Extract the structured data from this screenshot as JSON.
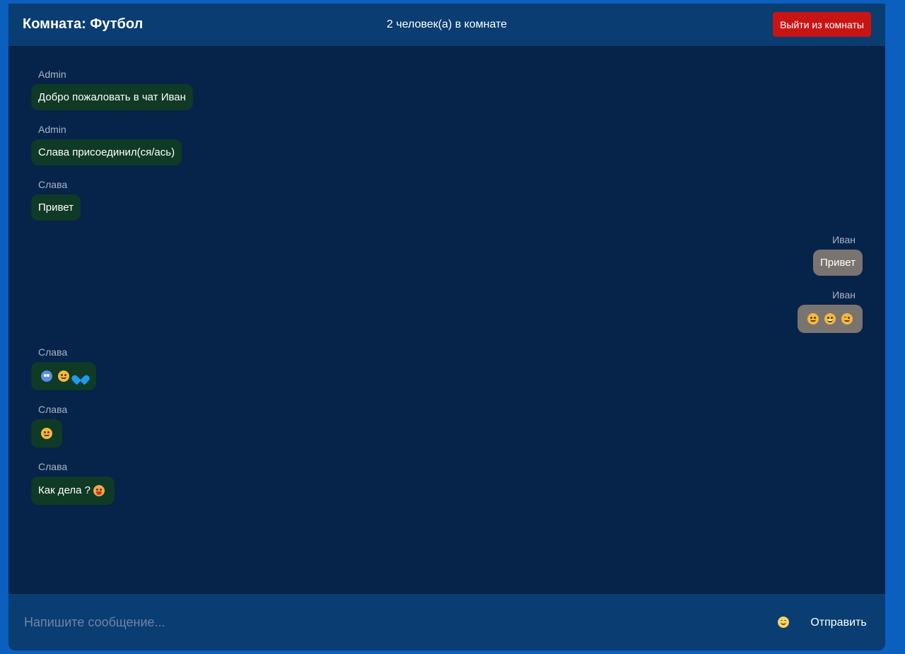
{
  "header": {
    "room_title": "Комната: Футбол",
    "online_count": "2 человек(а) в комнате",
    "leave_label": "Выйти из комнаты"
  },
  "colors": {
    "page_background": "#0b5fbf",
    "chat_background": "#06234a",
    "header_background": "#0a3d72",
    "leave_button": "#c91414",
    "incoming_bubble": "#0f3a26",
    "outgoing_bubble": "#7a7470"
  },
  "messages": [
    {
      "author": "Admin",
      "text": "Добро пожаловать в чат Иван",
      "side": "left"
    },
    {
      "author": "Admin",
      "text": "Слава присоединил(ся/ась)",
      "side": "left"
    },
    {
      "author": "Слава",
      "text": "Привет",
      "side": "left"
    },
    {
      "author": "Иван",
      "text": "Привет",
      "side": "right"
    },
    {
      "author": "Иван",
      "emojis": [
        "smiling-face",
        "grinning-face",
        "winking-face"
      ],
      "side": "right"
    },
    {
      "author": "Слава",
      "emojis": [
        "alien-monster-face",
        "smiling-face",
        "blue-heart"
      ],
      "side": "left"
    },
    {
      "author": "Слава",
      "emojis": [
        "waving-face"
      ],
      "side": "left"
    },
    {
      "author": "Слава",
      "text": "Как дела ?",
      "emojis": [
        "tongue-face"
      ],
      "side": "left"
    }
  ],
  "composer": {
    "placeholder": "Напишите сообщение...",
    "emoji_icon": "smiley-face-icon",
    "send_label": "Отправить"
  }
}
